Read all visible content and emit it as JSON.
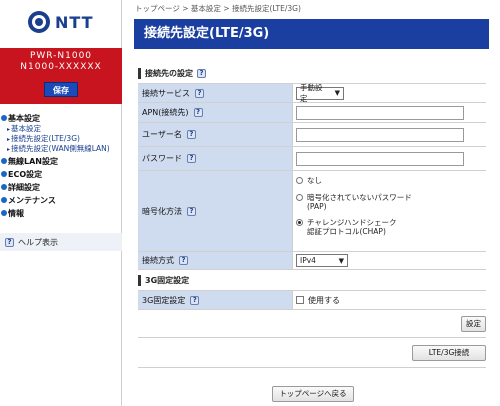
{
  "sidebar": {
    "logo_text": "NTT",
    "device": {
      "model": "PWR-N1000",
      "serial": "N1000-XXXXXX"
    },
    "save_label": "保存",
    "nav": [
      {
        "label": "基本設定",
        "subs": [
          "基本設定",
          "接続先設定(LTE/3G)",
          "接続先設定(WAN側無線LAN)"
        ]
      },
      {
        "label": "無線LAN設定",
        "subs": []
      },
      {
        "label": "ECO設定",
        "subs": []
      },
      {
        "label": "詳細設定",
        "subs": []
      },
      {
        "label": "メンテナンス",
        "subs": []
      },
      {
        "label": "情報",
        "subs": []
      }
    ],
    "help_label": "ヘルプ表示",
    "help_icon": "?"
  },
  "main": {
    "breadcrumb": "トップページ > 基本設定 > 接続先設定(LTE/3G)",
    "title": "接続先設定(LTE/3G)",
    "section1": {
      "title": "接続先の設定",
      "rows": {
        "service_label": "接続サービス",
        "service_value": "手動設定",
        "apn_label": "APN(接続先)",
        "username_label": "ユーザー名",
        "password_label": "パスワード",
        "encrypt_label": "暗号化方法",
        "encrypt_options": [
          {
            "label": "なし",
            "selected": false
          },
          {
            "label_line1": "暗号化されていないパスワード",
            "label_line2": "(PAP)",
            "selected": false
          },
          {
            "label_line1": "チャレンジハンドシェーク",
            "label_line2": "認証プロトコル(CHAP)",
            "selected": true
          }
        ],
        "conn_label": "接続方式",
        "conn_value": "IPv4"
      }
    },
    "section2": {
      "title": "3G固定設定",
      "row_label": "3G固定設定",
      "checkbox_label": "使用する"
    },
    "buttons": {
      "set": "設定",
      "lte3g_connect": "LTE/3G接続",
      "back_top": "トップページへ戻る"
    }
  }
}
